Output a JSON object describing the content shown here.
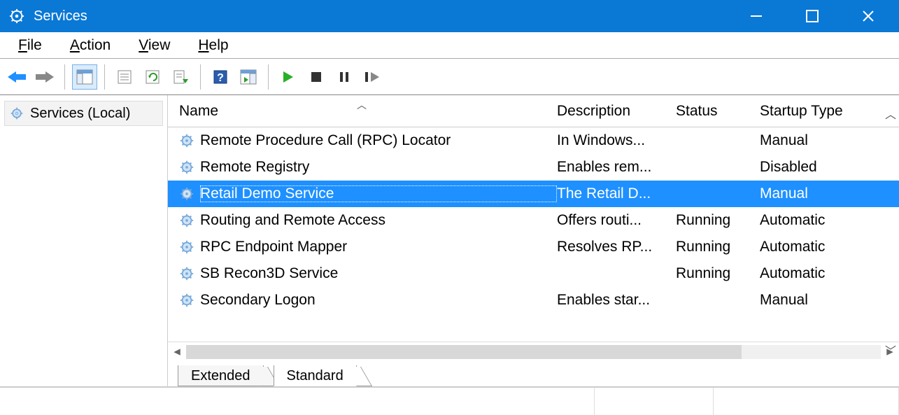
{
  "app": {
    "title": "Services"
  },
  "menus": {
    "file": "File",
    "action": "Action",
    "view": "View",
    "help": "Help"
  },
  "sidebar": {
    "root": "Services (Local)"
  },
  "columns": {
    "name": "Name",
    "description": "Description",
    "status": "Status",
    "startup": "Startup Type"
  },
  "tabs": {
    "extended": "Extended",
    "standard": "Standard"
  },
  "services": [
    {
      "name": "Remote Procedure Call (RPC) Locator",
      "description": "In Windows...",
      "status": "",
      "startup": "Manual",
      "selected": false
    },
    {
      "name": "Remote Registry",
      "description": "Enables rem...",
      "status": "",
      "startup": "Disabled",
      "selected": false
    },
    {
      "name": "Retail Demo Service",
      "description": "The Retail D...",
      "status": "",
      "startup": "Manual",
      "selected": true
    },
    {
      "name": "Routing and Remote Access",
      "description": "Offers routi...",
      "status": "Running",
      "startup": "Automatic",
      "selected": false
    },
    {
      "name": "RPC Endpoint Mapper",
      "description": "Resolves RP...",
      "status": "Running",
      "startup": "Automatic",
      "selected": false
    },
    {
      "name": "SB Recon3D Service",
      "description": "",
      "status": "Running",
      "startup": "Automatic",
      "selected": false
    },
    {
      "name": "Secondary Logon",
      "description": "Enables star...",
      "status": "",
      "startup": "Manual",
      "selected": false
    }
  ]
}
